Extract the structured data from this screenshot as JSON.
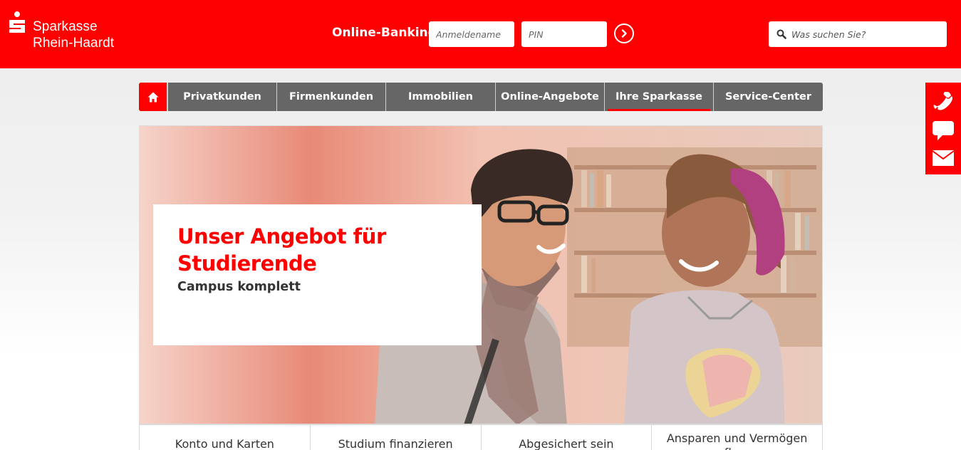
{
  "header": {
    "brand_line1": "Sparkasse",
    "brand_line2": "Rhein-Haardt",
    "online_banking_label": "Online-Banking",
    "username_placeholder": "Anmeldename",
    "pin_placeholder": "PIN",
    "search_placeholder": "Was suchen Sie?",
    "brand_color": "#ff0000"
  },
  "nav": {
    "items": [
      {
        "label": "Privatkunden"
      },
      {
        "label": "Firmenkunden"
      },
      {
        "label": "Immobilien"
      },
      {
        "label": "Online-Angebote"
      },
      {
        "label": "Ihre Sparkasse",
        "active": true
      },
      {
        "label": "Service-Center"
      }
    ]
  },
  "sidebar": {
    "icons": [
      "phone-icon",
      "chat-icon",
      "mail-icon"
    ]
  },
  "hero": {
    "title_line1": "Unser Angebot für",
    "title_line2": "Studierende",
    "subtitle": "Campus komplett"
  },
  "tiles": [
    {
      "label": "Konto und Karten"
    },
    {
      "label": "Studium finanzieren"
    },
    {
      "label": "Abgesichert sein"
    },
    {
      "label": "Ansparen und Vermögen",
      "label2": "aufbauen"
    }
  ]
}
